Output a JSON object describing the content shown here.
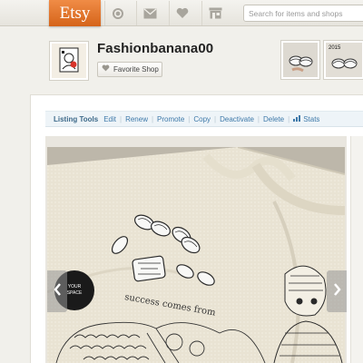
{
  "topbar": {
    "logo": "Etsy",
    "icons": [
      "activity-icon",
      "mail-icon",
      "heart-icon",
      "shop-icon"
    ],
    "search_placeholder": "Search for items and shops",
    "brand_color": "#e8742e"
  },
  "shop": {
    "name": "Fashionbanana00",
    "favorite_label": "Favorite Shop",
    "thumb2_label": "2015"
  },
  "listing_tools": {
    "label": "Listing Tools",
    "actions": [
      "Edit",
      "Renew",
      "Promote",
      "Copy",
      "Deactivate",
      "Delete",
      "Stats"
    ]
  },
  "photo": {
    "printed_text": "success comes from"
  },
  "colors": {
    "link": "#3e79a9",
    "toolbar_bg": "#eef4f8",
    "page_bg": "#f1f0eb"
  }
}
